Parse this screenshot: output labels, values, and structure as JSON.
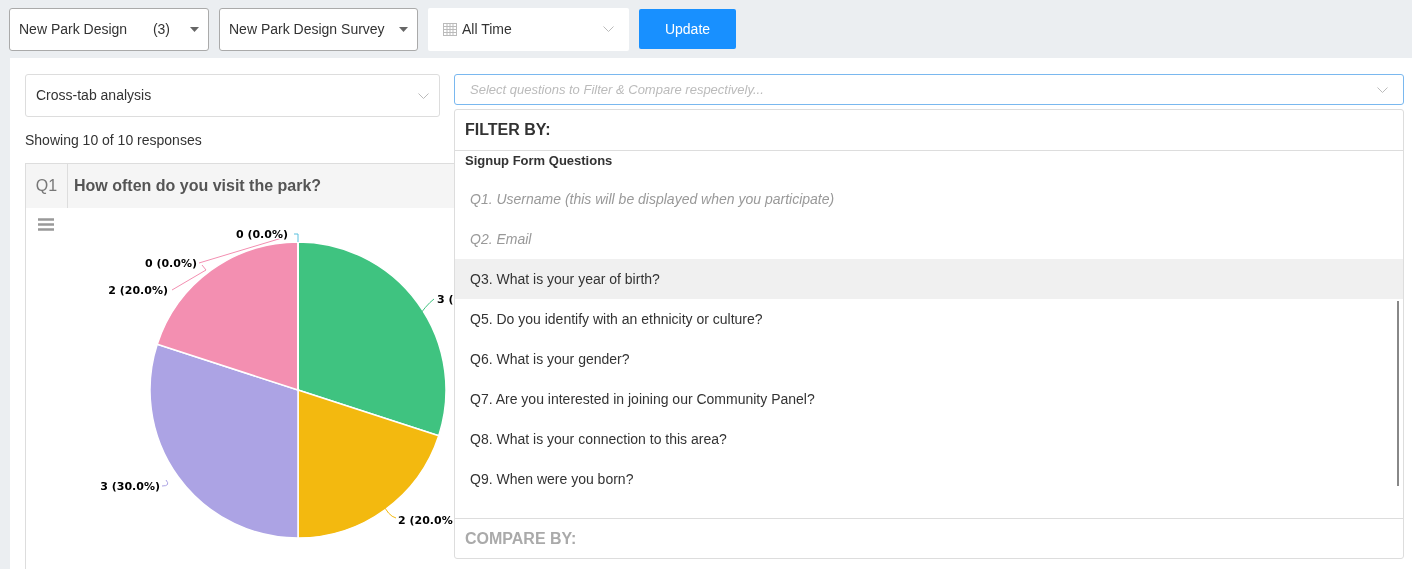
{
  "toolbar": {
    "project_select": {
      "value": "New Park Design",
      "count": "(3)"
    },
    "survey_select": {
      "value": "New Park Design Survey"
    },
    "date_select": {
      "value": "All Time"
    },
    "update_button": "Update"
  },
  "analysis_select": {
    "value": "Cross-tab analysis"
  },
  "question_field": {
    "placeholder": "Select questions to Filter & Compare respectively..."
  },
  "response_count": "Showing 10 of 10 responses",
  "question_card": {
    "number": "Q1",
    "title": "How often do you visit the park?",
    "chart_data": {
      "type": "pie",
      "values": [
        3,
        2,
        3,
        2,
        0,
        0
      ],
      "colors": [
        "#3fc380",
        "#f3b90f",
        "#aca3e4",
        "#f38fb1",
        "#f38fb1",
        "#5bc0de"
      ],
      "value_labels": [
        "3 (",
        "2 (20.0%",
        "3 (30.0%)",
        "2 (20.0%)",
        "0 (0.0%)",
        "0 (0.0%)"
      ]
    }
  },
  "dropdown": {
    "filter_heading": "FILTER BY:",
    "group_heading": "Signup Form Questions",
    "items": [
      {
        "label": "Q1. Username (this will be displayed when you participate)",
        "disabled": true,
        "selected": false
      },
      {
        "label": "Q2. Email",
        "disabled": true,
        "selected": false
      },
      {
        "label": "Q3. What is your year of birth?",
        "disabled": false,
        "selected": true
      },
      {
        "label": "Q5. Do you identify with an ethnicity or culture?",
        "disabled": false,
        "selected": false
      },
      {
        "label": "Q6. What is your gender?",
        "disabled": false,
        "selected": false
      },
      {
        "label": "Q7. Are you interested in joining our Community Panel?",
        "disabled": false,
        "selected": false
      },
      {
        "label": "Q8. What is your connection to this area?",
        "disabled": false,
        "selected": false
      },
      {
        "label": "Q9. When were you born?",
        "disabled": false,
        "selected": false
      }
    ],
    "compare_heading": "COMPARE BY:"
  }
}
